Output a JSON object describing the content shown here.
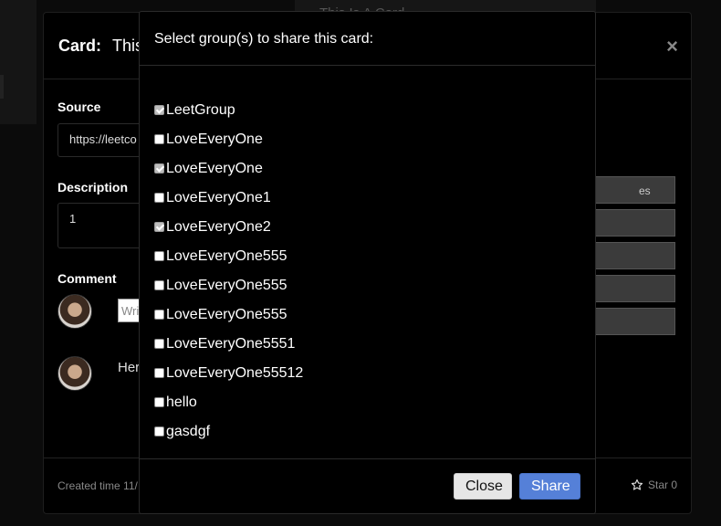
{
  "background": {
    "top_card_title": "This Is A Card"
  },
  "card": {
    "title_label": "Card:",
    "title_text": "This",
    "close_icon": "×",
    "source_label": "Source",
    "source_value": "https://leetco",
    "description_label": "Description",
    "description_value": "1",
    "comment_label": "Comment",
    "comment_placeholder": "Wri",
    "existing_comment": "Her",
    "side_button_1": "es",
    "created": "Created time 11/",
    "star_label": "Star 0"
  },
  "share": {
    "title": "Select group(s) to share this card:",
    "groups": [
      {
        "name": "LeetGroup",
        "checked": true
      },
      {
        "name": "LoveEveryOne",
        "checked": false
      },
      {
        "name": "LoveEveryOne",
        "checked": true
      },
      {
        "name": "LoveEveryOne1",
        "checked": false
      },
      {
        "name": "LoveEveryOne2",
        "checked": true
      },
      {
        "name": "LoveEveryOne555",
        "checked": false
      },
      {
        "name": "LoveEveryOne555",
        "checked": false
      },
      {
        "name": "LoveEveryOne555",
        "checked": false
      },
      {
        "name": "LoveEveryOne5551",
        "checked": false
      },
      {
        "name": "LoveEveryOne55512",
        "checked": false
      },
      {
        "name": "hello",
        "checked": false
      },
      {
        "name": "gasdgf",
        "checked": false
      }
    ],
    "close_label": "Close",
    "share_label": "Share"
  },
  "colors": {
    "share_button": "#5580d8",
    "close_button": "#e6e6e6",
    "background": "#0b0b0b"
  }
}
